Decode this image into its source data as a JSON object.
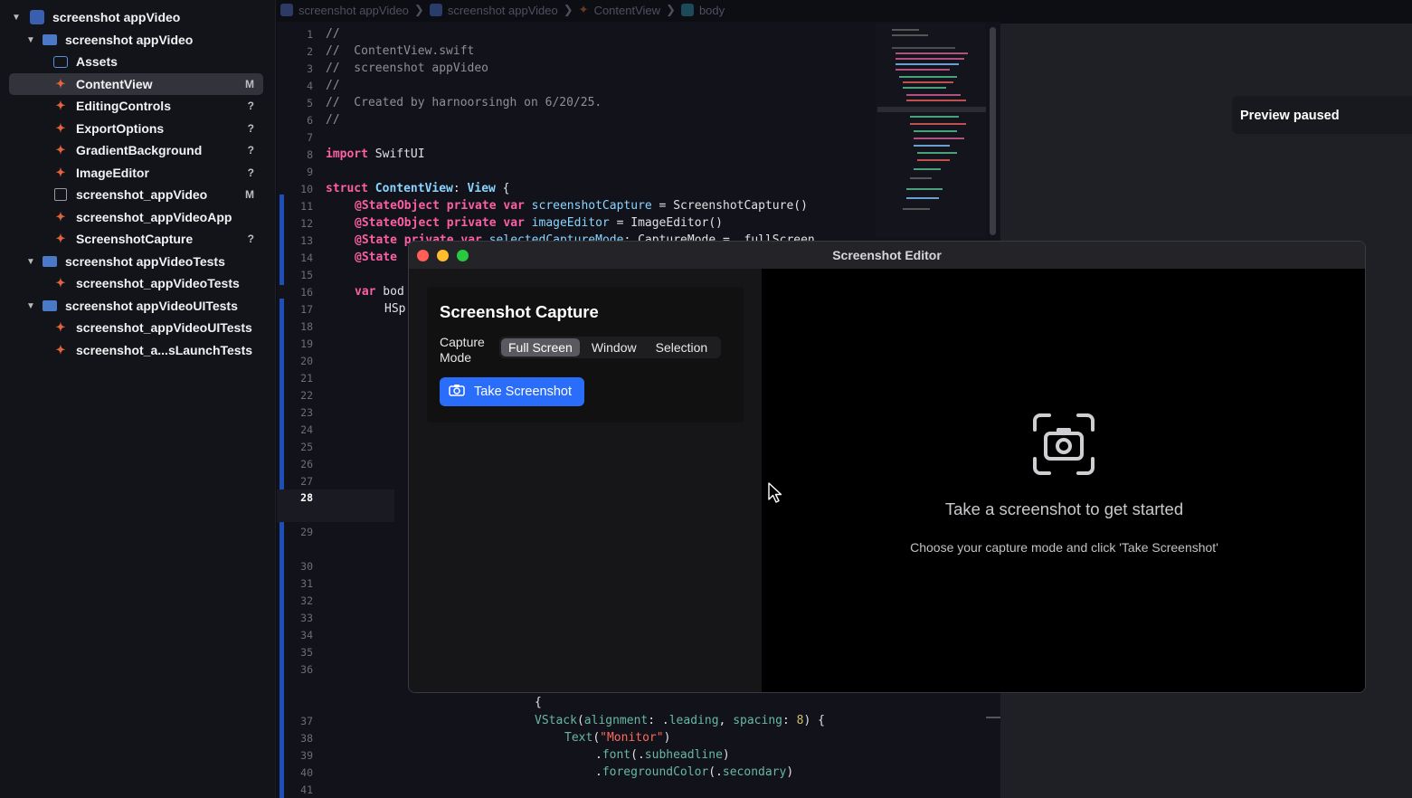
{
  "breadcrumb": [
    "screenshot appVideo",
    "screenshot appVideo",
    "ContentView",
    "body"
  ],
  "navigator": {
    "items": [
      {
        "label": "screenshot appVideo",
        "badge": "",
        "kind": "project"
      },
      {
        "label": "screenshot appVideo",
        "badge": "",
        "kind": "folder"
      },
      {
        "label": "Assets",
        "badge": "",
        "kind": "assets"
      },
      {
        "label": "ContentView",
        "badge": "M",
        "kind": "swift"
      },
      {
        "label": "EditingControls",
        "badge": "?",
        "kind": "swift"
      },
      {
        "label": "ExportOptions",
        "badge": "?",
        "kind": "swift"
      },
      {
        "label": "GradientBackground",
        "badge": "?",
        "kind": "swift"
      },
      {
        "label": "ImageEditor",
        "badge": "?",
        "kind": "swift"
      },
      {
        "label": "screenshot_appVideo",
        "badge": "M",
        "kind": "file"
      },
      {
        "label": "screenshot_appVideoApp",
        "badge": "",
        "kind": "swift"
      },
      {
        "label": "ScreenshotCapture",
        "badge": "?",
        "kind": "swift"
      },
      {
        "label": "screenshot appVideoTests",
        "badge": "",
        "kind": "folder"
      },
      {
        "label": "screenshot_appVideoTests",
        "badge": "",
        "kind": "swift"
      },
      {
        "label": "screenshot appVideoUITests",
        "badge": "",
        "kind": "folder"
      },
      {
        "label": "screenshot_appVideoUITests",
        "badge": "",
        "kind": "swift"
      },
      {
        "label": "screenshot_a...sLaunchTests",
        "badge": "",
        "kind": "swift"
      }
    ]
  },
  "editor": {
    "line_numbers": [
      "1",
      "2",
      "3",
      "4",
      "5",
      "6",
      "7",
      "8",
      "9",
      "10",
      "11",
      "12",
      "13",
      "14",
      "15",
      "16",
      "17",
      "18",
      "19",
      "20",
      "21",
      "22",
      "23",
      "24",
      "25",
      "26",
      "27",
      "28",
      "29",
      "30",
      "31",
      "32",
      "33",
      "34",
      "35",
      "36",
      "37",
      "38",
      "39",
      "40",
      "41"
    ],
    "current_line": "28",
    "code": {
      "l1": "//",
      "l2": "//  ContentView.swift",
      "l3": "//  screenshot appVideo",
      "l4": "//",
      "l5": "//  Created by harnoorsingh on 6/20/25.",
      "l6": "//",
      "l8_kw": "import",
      "l8_rest": " SwiftUI",
      "l10_kw": "struct",
      "l10_name": " ContentView",
      "l10_colon": ": ",
      "l10_type": "View",
      "l10_brace": " {",
      "l11_attr": "@StateObject",
      "l11_kw": " private var",
      "l11_var": " screenshotCapture",
      "l11_eq": " = ",
      "l11_type": "ScreenshotCapture",
      "l11_end": "()",
      "l12_attr": "@StateObject",
      "l12_kw": " private var",
      "l12_var": " imageEditor",
      "l12_eq": " = ",
      "l12_type": "ImageEditor",
      "l12_end": "()",
      "l13_attr": "@State",
      "l13_kw": " private var",
      "l13_var": " selectedCaptureMode",
      "l13_rest": ": CaptureMode = .fullScreen",
      "l14_attr": "@State",
      "l16_kw": "var",
      "l16_rest": " bod",
      "l17": "HSp",
      "l36b": "{",
      "l37_fn": "VStack",
      "l37_a": "(",
      "l37_arg1": "alignment",
      "l37_b": ": .",
      "l37_val1": "leading",
      "l37_c": ", ",
      "l37_arg2": "spacing",
      "l37_d": ": ",
      "l37_num": "8",
      "l37_e": ") {",
      "l38_fn": "Text",
      "l38_a": "(",
      "l38_str": "\"Monitor\"",
      "l38_b": ")",
      "l39_a": ".",
      "l39_fn": "font",
      "l39_b": "(.",
      "l39_val": "subheadline",
      "l39_c": ")",
      "l40_a": ".",
      "l40_fn": "foregroundColor",
      "l40_b": "(.",
      "l40_val": "secondary",
      "l40_c": ")"
    }
  },
  "preview": {
    "status": "Preview paused"
  },
  "app_window": {
    "title": "Screenshot Editor",
    "capture_title": "Screenshot Capture",
    "mode_label": "Capture Mode",
    "modes": [
      "Full Screen",
      "Window",
      "Selection"
    ],
    "selected_mode": "Full Screen",
    "take_button": "Take Screenshot",
    "empty_title": "Take a screenshot to get started",
    "empty_subtitle": "Choose your capture mode and click 'Take Screenshot'"
  },
  "colors": {
    "accent": "#2b6dfb",
    "close": "#ff5f57",
    "minimize": "#febc2e",
    "zoom": "#28c840",
    "keyword": "#fc5fa3",
    "type": "#8ad4ff"
  }
}
